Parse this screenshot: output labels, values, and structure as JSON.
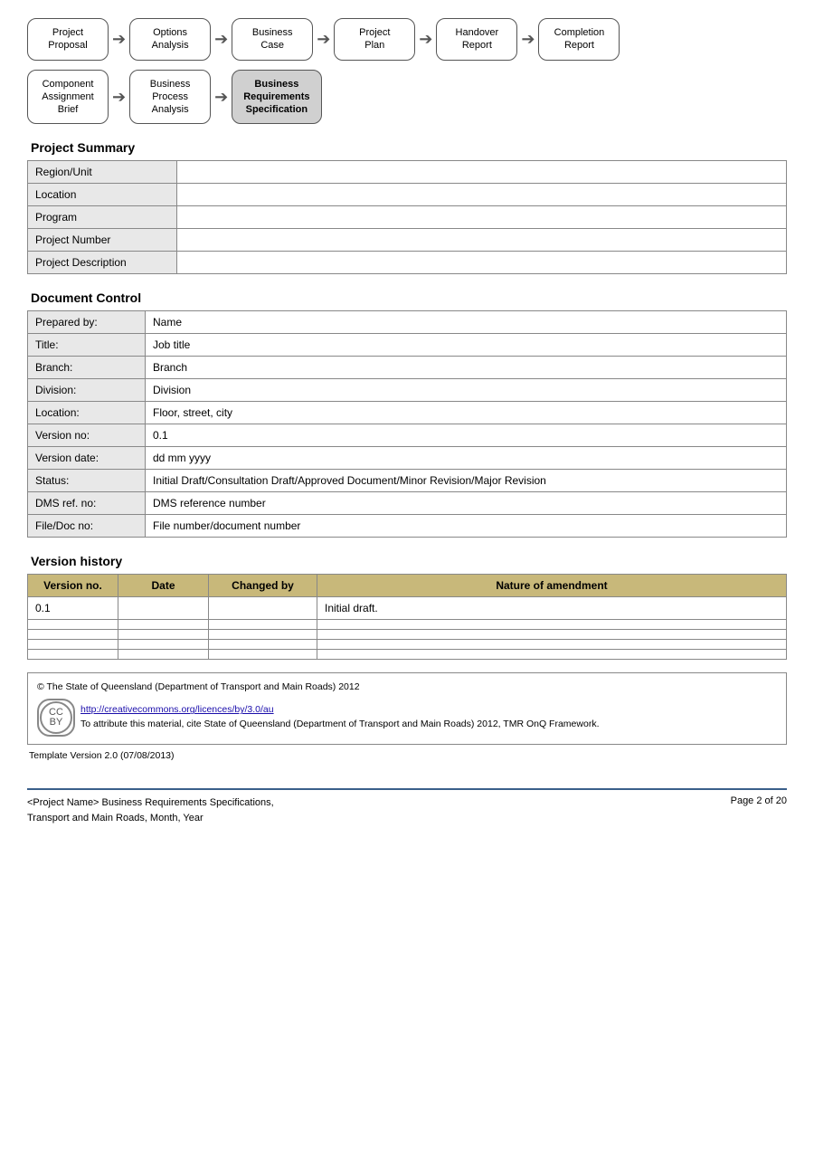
{
  "flow1": {
    "steps": [
      {
        "id": "step1",
        "line1": "Project",
        "line2": "Proposal",
        "active": false
      },
      {
        "id": "step2",
        "line1": "Options",
        "line2": "Analysis",
        "active": false
      },
      {
        "id": "step3",
        "line1": "Business",
        "line2": "Case",
        "active": false
      },
      {
        "id": "step4",
        "line1": "Project",
        "line2": "Plan",
        "active": false
      },
      {
        "id": "step5",
        "line1": "Handover",
        "line2": "Report",
        "active": false
      },
      {
        "id": "step6",
        "line1": "Completion",
        "line2": "Report",
        "active": false
      }
    ]
  },
  "flow2": {
    "steps": [
      {
        "id": "sub1",
        "line1": "Component",
        "line2": "Assignment",
        "line3": "Brief",
        "active": false
      },
      {
        "id": "sub2",
        "line1": "Business",
        "line2": "Process",
        "line3": "Analysis",
        "active": false
      },
      {
        "id": "sub3",
        "line1": "Business",
        "line2": "Requirements",
        "line3": "Specification",
        "active": true
      }
    ]
  },
  "projectSummary": {
    "heading": "Project Summary",
    "rows": [
      {
        "label": "Region/Unit",
        "value": ""
      },
      {
        "label": "Location",
        "value": ""
      },
      {
        "label": "Program",
        "value": ""
      },
      {
        "label": "Project Number",
        "value": ""
      },
      {
        "label": "Project Description",
        "value": ""
      }
    ]
  },
  "documentControl": {
    "heading": "Document Control",
    "rows": [
      {
        "label": "Prepared by:",
        "value": "Name"
      },
      {
        "label": "Title:",
        "value": "Job title"
      },
      {
        "label": "Branch:",
        "value": "Branch"
      },
      {
        "label": "Division:",
        "value": "Division"
      },
      {
        "label": "Location:",
        "value": "Floor, street, city"
      },
      {
        "label": "Version no:",
        "value": "0.1"
      },
      {
        "label": "Version date:",
        "value": "dd mm yyyy"
      },
      {
        "label": "Status:",
        "value": "Initial Draft/Consultation Draft/Approved Document/Minor Revision/Major Revision"
      },
      {
        "label": "DMS ref. no:",
        "value": "DMS reference number"
      },
      {
        "label": "File/Doc no:",
        "value": "File number/document number"
      }
    ]
  },
  "versionHistory": {
    "heading": "Version history",
    "columns": [
      "Version no.",
      "Date",
      "Changed by",
      "Nature of amendment"
    ],
    "rows": [
      {
        "version": "0.1",
        "date": "",
        "changedBy": "",
        "amendment": "Initial draft."
      },
      {
        "version": "",
        "date": "",
        "changedBy": "",
        "amendment": ""
      },
      {
        "version": "",
        "date": "",
        "changedBy": "",
        "amendment": ""
      },
      {
        "version": "",
        "date": "",
        "changedBy": "",
        "amendment": ""
      },
      {
        "version": "",
        "date": "",
        "changedBy": "",
        "amendment": ""
      }
    ]
  },
  "footer": {
    "copyright": "© The State of Queensland (Department of Transport and Main Roads) 2012",
    "link": "http://creativecommons.org/licences/by/3.0/au",
    "attribution": "To attribute this material, cite State of Queensland (Department of Transport and Main Roads) 2012, TMR OnQ Framework.",
    "templateVersion": "Template Version 2.0 (07/08/2013)"
  },
  "pageFooter": {
    "leftLine1": "<Project Name> Business Requirements Specifications,",
    "leftLine2": "Transport and Main Roads, Month, Year",
    "rightText": "Page 2 of 20"
  }
}
